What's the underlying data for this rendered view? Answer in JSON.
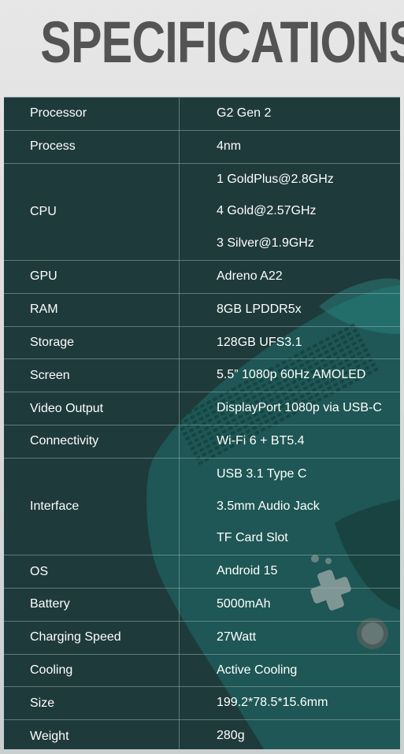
{
  "title": "SPECIFICATIONS",
  "colors": {
    "title": "#545454",
    "panel": "#1f3a3a",
    "device": "#1e6f6b",
    "text": "#ffffff"
  },
  "specs": [
    {
      "label": "Processor",
      "values": [
        "G2 Gen 2"
      ]
    },
    {
      "label": "Process",
      "values": [
        "4nm"
      ]
    },
    {
      "label": "CPU",
      "values": [
        "1 GoldPlus@2.8GHz",
        "4 Gold@2.57GHz",
        "3 Silver@1.9GHz"
      ]
    },
    {
      "label": "GPU",
      "values": [
        "Adreno A22"
      ]
    },
    {
      "label": "RAM",
      "values": [
        "8GB LPDDR5x"
      ]
    },
    {
      "label": "Storage",
      "values": [
        "128GB UFS3.1"
      ]
    },
    {
      "label": "Screen",
      "values": [
        "5.5” 1080p 60Hz AMOLED"
      ]
    },
    {
      "label": "Video Output",
      "values": [
        "DisplayPort 1080p via USB-C"
      ]
    },
    {
      "label": "Connectivity",
      "values": [
        "Wi-Fi 6 + BT5.4"
      ]
    },
    {
      "label": "Interface",
      "values": [
        "USB 3.1 Type C",
        "3.5mm Audio Jack",
        "TF Card Slot"
      ]
    },
    {
      "label": "OS",
      "values": [
        "Android 15"
      ]
    },
    {
      "label": "Battery",
      "values": [
        "5000mAh"
      ]
    },
    {
      "label": "Charging Speed",
      "values": [
        "27Watt"
      ]
    },
    {
      "label": "Cooling",
      "values": [
        "Active Cooling"
      ]
    },
    {
      "label": "Size",
      "values": [
        "199.2*78.5*15.6mm"
      ]
    },
    {
      "label": "Weight",
      "values": [
        "280g"
      ]
    }
  ]
}
